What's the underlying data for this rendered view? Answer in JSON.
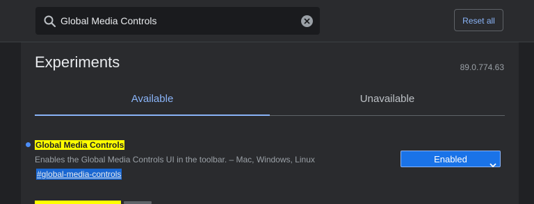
{
  "search": {
    "value": "Global Media Controls",
    "search_icon": "search-icon",
    "clear_icon": "clear-icon"
  },
  "header": {
    "reset_label": "Reset all"
  },
  "page": {
    "title": "Experiments",
    "version": "89.0.774.63"
  },
  "tabs": [
    {
      "label": "Available",
      "active": true
    },
    {
      "label": "Unavailable",
      "active": false
    }
  ],
  "flag": {
    "name": "Global Media Controls",
    "description": "Enables the Global Media Controls UI in the toolbar. – Mac, Windows, Linux",
    "link": "#global-media-controls",
    "selected_option": "Enabled",
    "modified_indicator_color": "#4c8df6"
  },
  "colors": {
    "accent": "#8ab4f8",
    "highlight": "#ffff00",
    "select_bg": "#1a73e8",
    "background": "#202124",
    "panel": "#2a2b2e"
  }
}
